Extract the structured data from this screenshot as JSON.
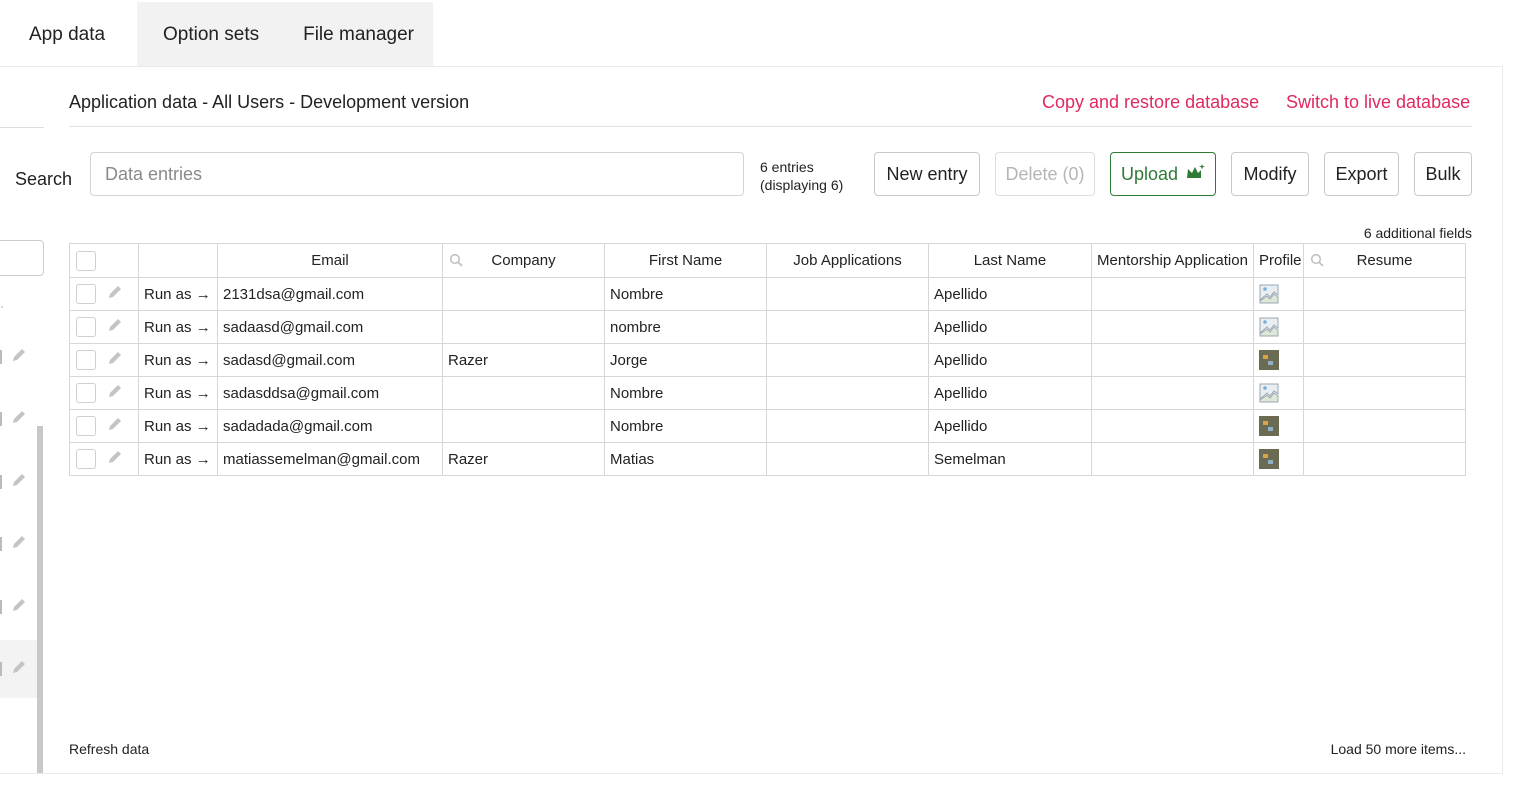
{
  "tabs": [
    "App data",
    "Option sets",
    "File manager"
  ],
  "header": {
    "title": "Application data - All Users - Development version",
    "copy_restore": "Copy and restore database",
    "switch_live": "Switch to live database"
  },
  "search": {
    "label": "Search",
    "placeholder": "Data entries",
    "count_line1": "6 entries",
    "count_line2": "(displaying 6)"
  },
  "buttons": {
    "new_entry": "New entry",
    "delete": "Delete (0)",
    "upload": "Upload",
    "modify": "Modify",
    "export": "Export",
    "bulk": "Bulk"
  },
  "additional_fields": "6 additional fields",
  "table": {
    "columns": [
      "Email",
      "Company",
      "First Name",
      "Job Applications",
      "Last Name",
      "Mentorship Application",
      "Profile",
      "Resume"
    ],
    "run_as_label": "Run as →",
    "rows": [
      {
        "email": "2131dsa@gmail.com",
        "company": "",
        "first_name": "Nombre",
        "job_applications": "",
        "last_name": "Apellido",
        "mentorship": "",
        "profile": "broken",
        "resume": ""
      },
      {
        "email": "sadaasd@gmail.com",
        "company": "",
        "first_name": "nombre",
        "job_applications": "",
        "last_name": "Apellido",
        "mentorship": "",
        "profile": "broken",
        "resume": ""
      },
      {
        "email": "sadasd@gmail.com",
        "company": "Razer",
        "first_name": "Jorge",
        "job_applications": "",
        "last_name": "Apellido",
        "mentorship": "",
        "profile": "thumb",
        "resume": ""
      },
      {
        "email": "sadasddsa@gmail.com",
        "company": "",
        "first_name": "Nombre",
        "job_applications": "",
        "last_name": "Apellido",
        "mentorship": "",
        "profile": "broken",
        "resume": ""
      },
      {
        "email": "sadadada@gmail.com",
        "company": "",
        "first_name": "Nombre",
        "job_applications": "",
        "last_name": "Apellido",
        "mentorship": "",
        "profile": "thumb",
        "resume": ""
      },
      {
        "email": "matiassemelman@gmail.com",
        "company": "Razer",
        "first_name": "Matias",
        "job_applications": "",
        "last_name": "Semelman",
        "mentorship": "",
        "profile": "thumb",
        "resume": ""
      }
    ]
  },
  "footer": {
    "refresh": "Refresh data",
    "load_more": "Load 50 more items..."
  },
  "colors": {
    "link_accent": "#e0295f",
    "upload_green": "#2f7a37"
  },
  "icons": [
    "pencil-icon",
    "search-icon",
    "crown-sparkle-icon",
    "broken-image-icon",
    "profile-thumbnail-icon"
  ]
}
